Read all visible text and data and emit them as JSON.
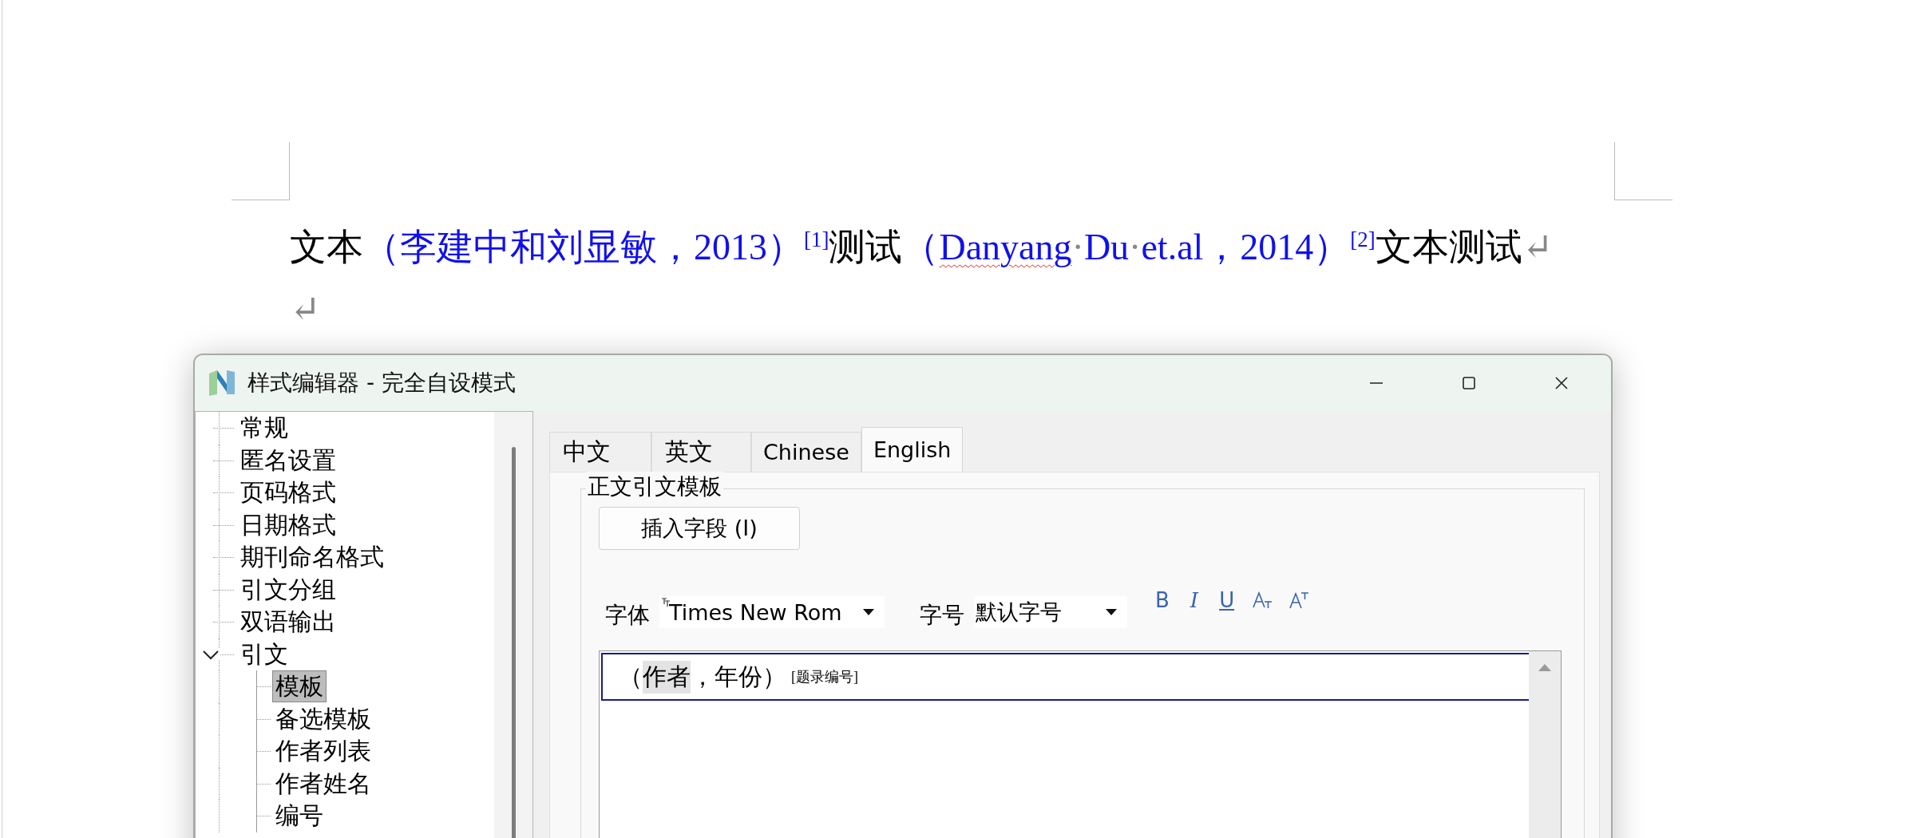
{
  "document": {
    "paragraphs": [
      {
        "segments": [
          {
            "kind": "text",
            "text": "文本"
          },
          {
            "kind": "citation",
            "text": "（李建中和刘显敏，2013）"
          },
          {
            "kind": "citation",
            "text": "[1]",
            "superscript": true
          },
          {
            "kind": "text",
            "text": "测试"
          },
          {
            "kind": "citation",
            "text": "（"
          },
          {
            "kind": "citation",
            "text": "Danyang",
            "misspelled": true
          },
          {
            "kind": "mark",
            "text": "·"
          },
          {
            "kind": "citation",
            "text": "Du"
          },
          {
            "kind": "mark",
            "text": "·"
          },
          {
            "kind": "citation",
            "text": "et.al，2014）"
          },
          {
            "kind": "citation",
            "text": "[2]",
            "superscript": true
          },
          {
            "kind": "text",
            "text": "文本测试"
          },
          {
            "kind": "mark",
            "text": "↵"
          }
        ]
      },
      {
        "segments": [
          {
            "kind": "mark",
            "text": "↵"
          }
        ]
      }
    ]
  },
  "dialog": {
    "title": "样式编辑器 - 完全自设模式",
    "tree": [
      {
        "label": "常规",
        "selected": false
      },
      {
        "label": "匿名设置",
        "selected": false
      },
      {
        "label": "页码格式",
        "selected": false
      },
      {
        "label": "日期格式",
        "selected": false
      },
      {
        "label": "期刊命名格式",
        "selected": false
      },
      {
        "label": "引文分组",
        "selected": false
      },
      {
        "label": "双语输出",
        "selected": false
      },
      {
        "label": "引文",
        "selected": false,
        "expanded": true,
        "children": [
          {
            "label": "模板",
            "selected": true
          },
          {
            "label": "备选模板",
            "selected": false
          },
          {
            "label": "作者列表",
            "selected": false
          },
          {
            "label": "作者姓名",
            "selected": false
          },
          {
            "label": "编号",
            "selected": false
          }
        ]
      }
    ],
    "tabs": [
      {
        "label": "中文",
        "selected": false
      },
      {
        "label": "英文",
        "selected": false
      },
      {
        "label": "Chinese",
        "selected": false
      },
      {
        "label": "English",
        "selected": true
      }
    ],
    "group_title": "正文引文模板",
    "insert_button": "插入字段 (I)",
    "font_label": "字体",
    "font_value": "Times New Rom",
    "size_label": "字号",
    "size_value": "默认字号",
    "format_buttons": [
      {
        "kind": "bold",
        "label": "B"
      },
      {
        "kind": "italic",
        "label": "I"
      },
      {
        "kind": "underline",
        "label": "U"
      },
      {
        "kind": "subscript"
      },
      {
        "kind": "superscript"
      }
    ],
    "template": [
      {
        "kind": "text",
        "text": "（"
      },
      {
        "kind": "field",
        "text": "作者"
      },
      {
        "kind": "text",
        "text": "，年份）"
      },
      {
        "kind": "small",
        "text": "[题录编号]"
      }
    ]
  }
}
